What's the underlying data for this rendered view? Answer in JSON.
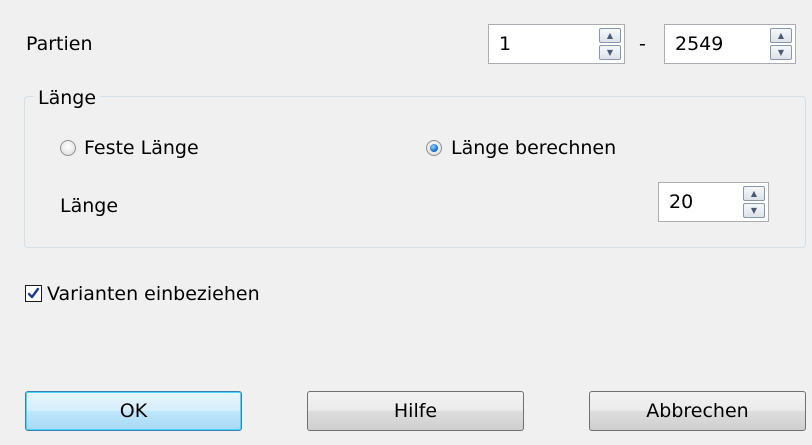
{
  "partien": {
    "label": "Partien",
    "from_value": "1",
    "separator": "-",
    "to_value": "2549"
  },
  "laenge_group": {
    "title": "Länge",
    "radio_fixed": {
      "label": "Feste Länge",
      "checked": false
    },
    "radio_compute": {
      "label": "Länge berechnen",
      "checked": true
    },
    "length_label": "Länge",
    "length_value": "20"
  },
  "variants_checkbox": {
    "label": "Varianten einbeziehen",
    "checked": true
  },
  "buttons": {
    "ok": "OK",
    "help": "Hilfe",
    "cancel": "Abbrechen"
  },
  "colors": {
    "dialog_bg": "#f0f0f0",
    "default_button_accent": "#3c7fb1",
    "radio_selected": "#1f6fc9"
  }
}
